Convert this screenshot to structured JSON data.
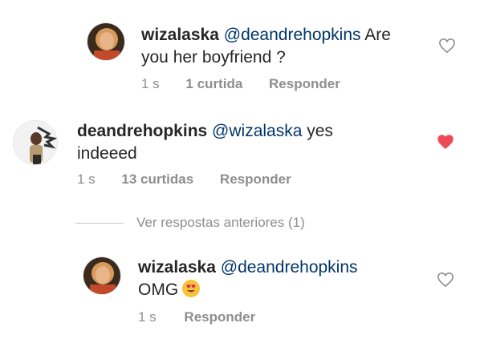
{
  "comments": [
    {
      "username": "wizalaska",
      "mention": "@deandrehopkins",
      "text_line1": " Are",
      "text_line2": "you her boyfriend ?",
      "time": "1 s",
      "likes": "1 curtida",
      "reply": "Responder",
      "liked": false,
      "avatar_icon": "profile-photo-woman-icon"
    },
    {
      "username": "deandrehopkins",
      "mention": "@wizalaska",
      "text_line1": " yes",
      "text_line2": "indeeed",
      "time": "1 s",
      "likes": "13 curtidas",
      "reply": "Responder",
      "liked": true,
      "avatar_icon": "profile-photo-man-icon"
    },
    {
      "username": "wizalaska",
      "mention": "@deandrehopkins",
      "text_line1": "",
      "text_line2": "OMG",
      "emoji": "heart-eyes-emoji",
      "time": "1 s",
      "reply": "Responder",
      "liked": false,
      "avatar_icon": "profile-photo-woman-icon"
    }
  ],
  "view_replies": "Ver respostas anteriores (1)",
  "colors": {
    "mention": "#003569",
    "liked_heart": "#ed4956",
    "meta_text": "#8e8e8e"
  }
}
